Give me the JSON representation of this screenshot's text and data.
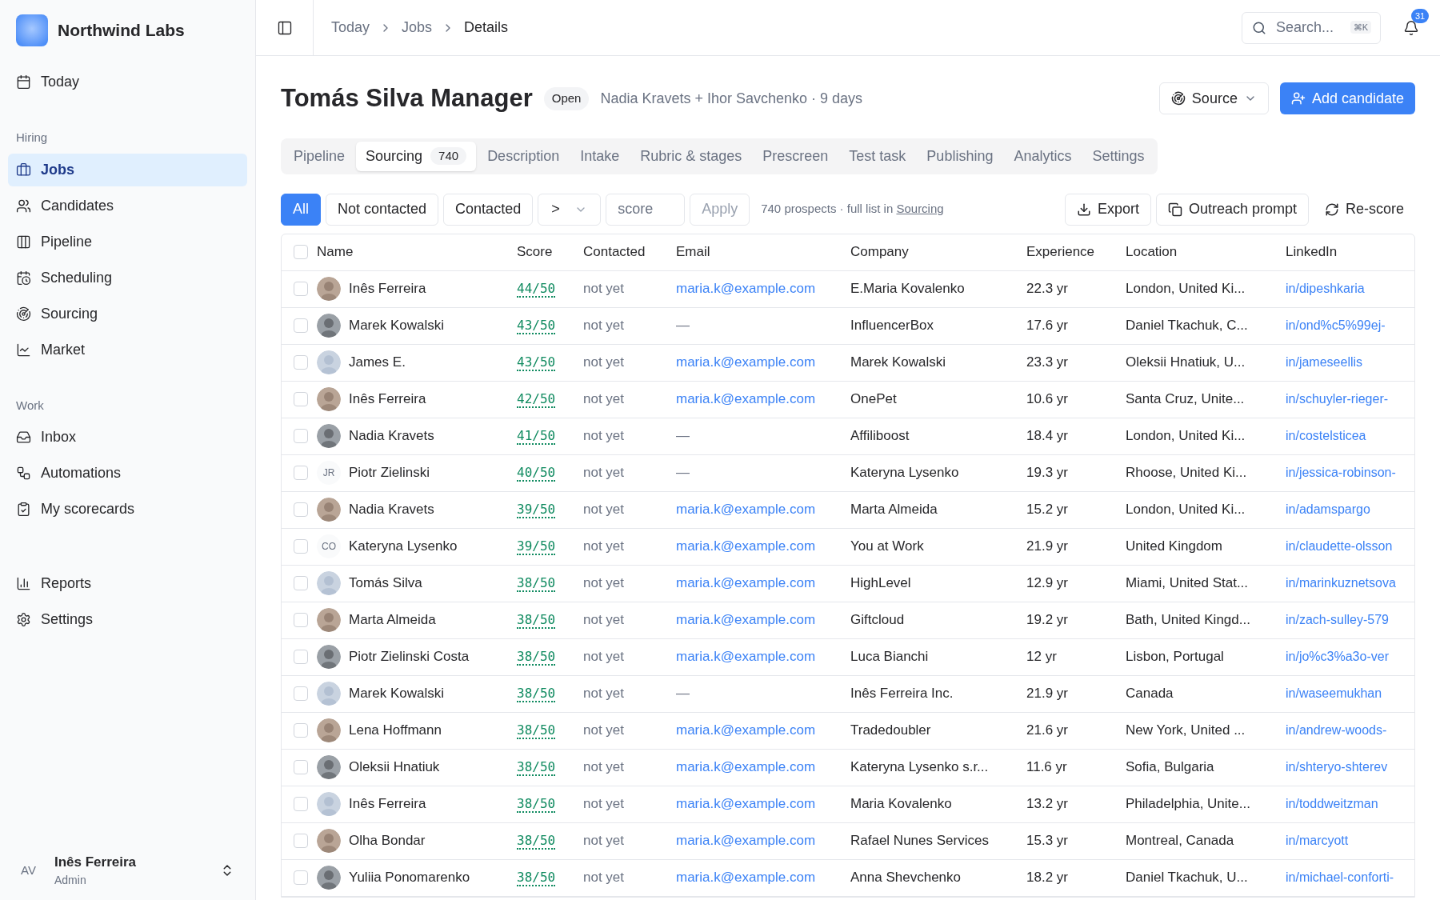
{
  "sidebar": {
    "brand": "Northwind Labs",
    "sections": [
      {
        "items": [
          {
            "label": "Today",
            "selected": false
          }
        ]
      },
      {
        "heading": "Hiring",
        "items": [
          {
            "label": "Jobs",
            "selected": true
          },
          {
            "label": "Candidates",
            "selected": false
          },
          {
            "label": "Pipeline",
            "selected": false
          },
          {
            "label": "Scheduling",
            "selected": false
          },
          {
            "label": "Sourcing",
            "selected": false
          },
          {
            "label": "Market",
            "selected": false
          }
        ]
      },
      {
        "heading": "Work",
        "items": [
          {
            "label": "Inbox",
            "selected": false
          },
          {
            "label": "Automations",
            "selected": false
          },
          {
            "label": "My scorecards",
            "selected": false
          }
        ]
      },
      {
        "items": [
          {
            "label": "Reports",
            "selected": false
          },
          {
            "label": "Settings",
            "selected": false
          }
        ]
      }
    ],
    "user": {
      "initials": "AV",
      "name": "Inês Ferreira",
      "role": "Admin"
    }
  },
  "topbar": {
    "breadcrumbs": [
      "Today",
      "Jobs",
      "Details"
    ],
    "search": {
      "placeholder": "Search...",
      "shortcut": "⌘K"
    },
    "notifications": "31"
  },
  "job": {
    "title": "Tomás Silva Manager",
    "status": "Open",
    "meta": "Nadia Kravets + Ihor Savchenko · 9 days",
    "buttons": {
      "source": "Source",
      "add": "Add candidate"
    }
  },
  "tabs": [
    {
      "label": "Pipeline",
      "selected": false
    },
    {
      "label": "Sourcing",
      "selected": true,
      "count": "740"
    },
    {
      "label": "Description",
      "selected": false
    },
    {
      "label": "Intake",
      "selected": false
    },
    {
      "label": "Rubric & stages",
      "selected": false
    },
    {
      "label": "Prescreen",
      "selected": false
    },
    {
      "label": "Test task",
      "selected": false
    },
    {
      "label": "Publishing",
      "selected": false
    },
    {
      "label": "Analytics",
      "selected": false
    },
    {
      "label": "Settings",
      "selected": false
    }
  ],
  "filters": {
    "chips": [
      {
        "label": "All",
        "selected": true
      },
      {
        "label": "Not contacted",
        "selected": false
      },
      {
        "label": "Contacted",
        "selected": false
      }
    ],
    "operator": ">",
    "score_placeholder": "score",
    "apply": {
      "label": "Apply",
      "disabled": true
    },
    "summary": "740 prospects · full list in ",
    "summary_link": "Sourcing",
    "actions": [
      "Export",
      "Outreach prompt",
      "Re-score"
    ]
  },
  "table": {
    "select_all": {
      "checked": false
    },
    "columns": [
      "Name",
      "Score",
      "Contacted",
      "Email",
      "Company",
      "Experience",
      "Location",
      "LinkedIn"
    ],
    "rows": [
      {
        "checked": false,
        "name": "Inês Ferreira",
        "score": "44/50",
        "contacted": "not yet",
        "email": "maria.k@example.com",
        "company": "E.Maria Kovalenko",
        "experience": "22.3 yr",
        "location": "London, United Ki...",
        "linkedin": "in/dipeshkaria"
      },
      {
        "checked": false,
        "name": "Marek Kowalski",
        "score": "43/50",
        "contacted": "not yet",
        "email": "—",
        "company": "InfluencerBox",
        "experience": "17.6 yr",
        "location": "Daniel Tkachuk, C...",
        "linkedin": "in/ond%c5%99ej-"
      },
      {
        "checked": false,
        "name": "James E.",
        "score": "43/50",
        "contacted": "not yet",
        "email": "maria.k@example.com",
        "company": "Marek Kowalski",
        "experience": "23.3 yr",
        "location": "Oleksii Hnatiuk, U...",
        "linkedin": "in/jameseellis"
      },
      {
        "checked": false,
        "name": "Inês Ferreira",
        "score": "42/50",
        "contacted": "not yet",
        "email": "maria.k@example.com",
        "company": "OnePet",
        "experience": "10.6 yr",
        "location": "Santa Cruz, Unite...",
        "linkedin": "in/schuyler-rieger-"
      },
      {
        "checked": false,
        "name": "Nadia Kravets",
        "score": "41/50",
        "contacted": "not yet",
        "email": "—",
        "company": "Affiliboost",
        "experience": "18.4 yr",
        "location": "London, United Ki...",
        "linkedin": "in/costelsticea"
      },
      {
        "checked": false,
        "avatar": {
          "kind": "initials",
          "text": "JR"
        },
        "name": "Piotr Zielinski",
        "score": "40/50",
        "contacted": "not yet",
        "email": "—",
        "company": "Kateryna Lysenko",
        "experience": "19.3 yr",
        "location": "Rhoose, United Ki...",
        "linkedin": "in/jessica-robinson-"
      },
      {
        "checked": false,
        "name": "Nadia Kravets",
        "score": "39/50",
        "contacted": "not yet",
        "email": "maria.k@example.com",
        "company": "Marta Almeida",
        "experience": "15.2 yr",
        "location": "London, United Ki...",
        "linkedin": "in/adamspargo"
      },
      {
        "checked": false,
        "avatar": {
          "kind": "initials",
          "text": "CO"
        },
        "name": "Kateryna Lysenko",
        "score": "39/50",
        "contacted": "not yet",
        "email": "maria.k@example.com",
        "company": "You at Work",
        "experience": "21.9 yr",
        "location": "United Kingdom",
        "linkedin": "in/claudette-olsson"
      },
      {
        "checked": false,
        "name": "Tomás Silva",
        "score": "38/50",
        "contacted": "not yet",
        "email": "maria.k@example.com",
        "company": "HighLevel",
        "experience": "12.9 yr",
        "location": "Miami, United Stat...",
        "linkedin": "in/marinkuznetsova"
      },
      {
        "checked": false,
        "name": "Marta Almeida",
        "score": "38/50",
        "contacted": "not yet",
        "email": "maria.k@example.com",
        "company": "Giftcloud",
        "experience": "19.2 yr",
        "location": "Bath, United Kingd...",
        "linkedin": "in/zach-sulley-579"
      },
      {
        "checked": false,
        "name": "Piotr Zielinski Costa",
        "score": "38/50",
        "contacted": "not yet",
        "email": "maria.k@example.com",
        "company": "Luca Bianchi",
        "experience": "12 yr",
        "location": "Lisbon, Portugal",
        "linkedin": "in/jo%c3%a3o-ver"
      },
      {
        "checked": false,
        "name": "Marek Kowalski",
        "score": "38/50",
        "contacted": "not yet",
        "email": "—",
        "company": "Inês Ferreira Inc.",
        "experience": "21.9 yr",
        "location": "Canada",
        "linkedin": "in/waseemukhan"
      },
      {
        "checked": false,
        "name": "Lena Hoffmann",
        "score": "38/50",
        "contacted": "not yet",
        "email": "maria.k@example.com",
        "company": "Tradedoubler",
        "experience": "21.6 yr",
        "location": "New York, United ...",
        "linkedin": "in/andrew-woods-"
      },
      {
        "checked": false,
        "name": "Oleksii Hnatiuk",
        "score": "38/50",
        "contacted": "not yet",
        "email": "maria.k@example.com",
        "company": "Kateryna Lysenko s.r...",
        "experience": "11.6 yr",
        "location": "Sofia, Bulgaria",
        "linkedin": "in/shteryo-shterev"
      },
      {
        "checked": false,
        "name": "Inês Ferreira",
        "score": "38/50",
        "contacted": "not yet",
        "email": "maria.k@example.com",
        "company": "Maria Kovalenko",
        "experience": "13.2 yr",
        "location": "Philadelphia, Unite...",
        "linkedin": "in/toddweitzman"
      },
      {
        "checked": false,
        "name": "Olha Bondar",
        "score": "38/50",
        "contacted": "not yet",
        "email": "maria.k@example.com",
        "company": "Rafael Nunes Services",
        "experience": "15.3 yr",
        "location": "Montreal, Canada",
        "linkedin": "in/marcyott"
      },
      {
        "checked": false,
        "name": "Yuliia Ponomarenko",
        "score": "38/50",
        "contacted": "not yet",
        "email": "maria.k@example.com",
        "company": "Anna Shevchenko",
        "experience": "18.2 yr",
        "location": "Daniel Tkachuk, U...",
        "linkedin": "in/michael-conforti-"
      }
    ]
  }
}
